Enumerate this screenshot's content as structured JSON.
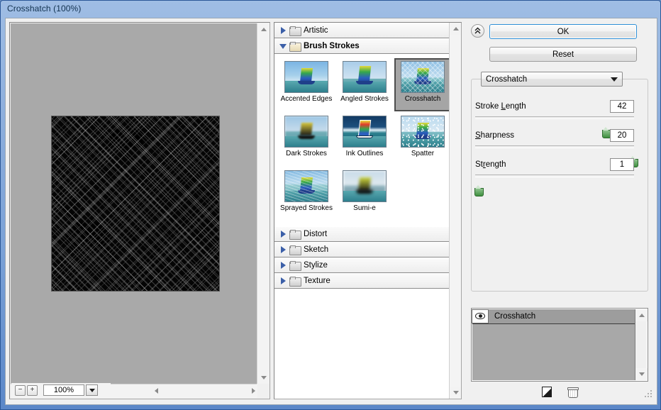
{
  "window": {
    "title": "Crosshatch (100%)"
  },
  "preview": {
    "zoom_out_label": "−",
    "zoom_in_label": "+",
    "zoom_value": "100%",
    "zoom_dropdown_icon": "chevron-down-icon",
    "scroll_up_icon": "triangle-up-icon",
    "scroll_down_icon": "triangle-down-icon",
    "scroll_left_icon": "triangle-left-icon",
    "scroll_right_icon": "triangle-right-icon"
  },
  "gallery": {
    "categories": [
      {
        "label": "Artistic",
        "expanded": false,
        "icon": "folder-closed-icon",
        "disclosure": "triangle-right-icon"
      },
      {
        "label": "Brush Strokes",
        "expanded": true,
        "icon": "folder-open-icon",
        "disclosure": "triangle-down-icon"
      },
      {
        "label": "Distort",
        "expanded": false,
        "icon": "folder-closed-icon",
        "disclosure": "triangle-right-icon"
      },
      {
        "label": "Sketch",
        "expanded": false,
        "icon": "folder-closed-icon",
        "disclosure": "triangle-right-icon"
      },
      {
        "label": "Stylize",
        "expanded": false,
        "icon": "folder-closed-icon",
        "disclosure": "triangle-right-icon"
      },
      {
        "label": "Texture",
        "expanded": false,
        "icon": "folder-closed-icon",
        "disclosure": "triangle-right-icon"
      }
    ],
    "filters": [
      {
        "label": "Accented Edges",
        "selected": false
      },
      {
        "label": "Angled Strokes",
        "selected": false
      },
      {
        "label": "Crosshatch",
        "selected": true
      },
      {
        "label": "Dark Strokes",
        "selected": false
      },
      {
        "label": "Ink Outlines",
        "selected": false
      },
      {
        "label": "Spatter",
        "selected": false
      },
      {
        "label": "Sprayed Strokes",
        "selected": false
      },
      {
        "label": "Sumi-e",
        "selected": false
      }
    ]
  },
  "options": {
    "collapse_icon": "double-chevron-up-icon",
    "ok_label": "OK",
    "reset_label": "Reset",
    "filter_select_value": "Crosshatch",
    "filter_select_icon": "chevron-down-icon",
    "params": [
      {
        "label_pre": "Stroke ",
        "label_accel": "L",
        "label_post": "ength",
        "value": "42",
        "percent": 82
      },
      {
        "label_pre": "",
        "label_accel": "S",
        "label_post": "harpness",
        "value": "20",
        "percent": 99
      },
      {
        "label_pre": "St",
        "label_accel": "r",
        "label_post": "ength",
        "value": "1",
        "percent": 2
      }
    ]
  },
  "layers": {
    "items": [
      {
        "name": "Crosshatch",
        "visible": true,
        "visibility_icon": "eye-icon"
      }
    ],
    "new_layer_icon": "new-effect-layer-icon",
    "delete_icon": "trash-icon",
    "scroll_up_icon": "triangle-up-icon",
    "scroll_down_icon": "triangle-down-icon"
  },
  "colors": {
    "accent_blue": "#2f8fd6",
    "title_gradient_top": "#9fbde4",
    "title_gradient_bottom": "#5b87c8",
    "canvas_gray": "#a9a9a9",
    "selection_gray": "#a5a5a5"
  }
}
